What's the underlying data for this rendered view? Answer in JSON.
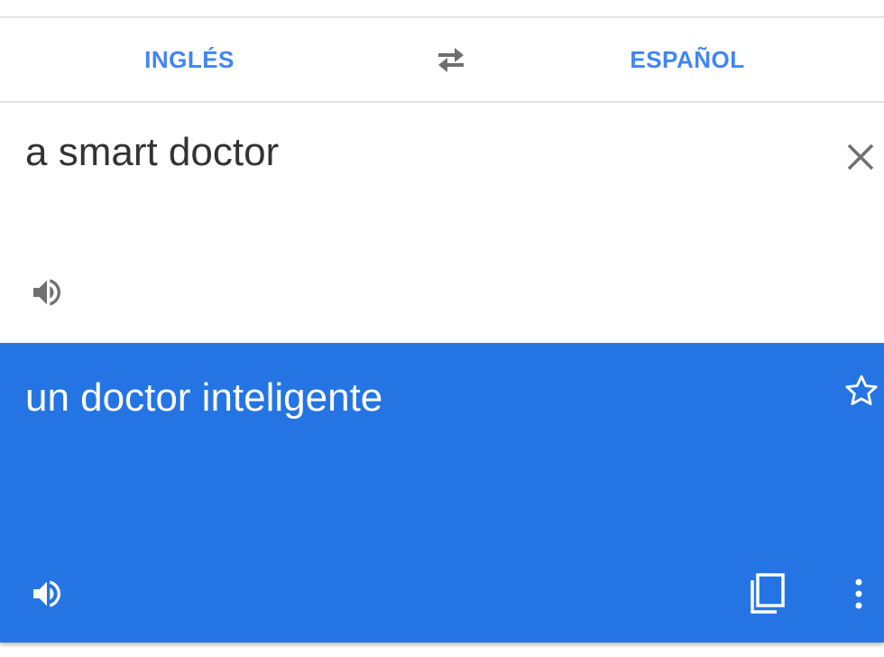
{
  "languages": {
    "source_label": "INGLÉS",
    "target_label": "ESPAÑOL",
    "swap_icon": "swap-arrows-icon"
  },
  "source": {
    "text": "a smart doctor",
    "clear_icon": "close-icon",
    "speaker_icon": "speaker-icon"
  },
  "result": {
    "text": "un doctor inteligente",
    "star_icon": "star-outline-icon",
    "speaker_icon": "speaker-icon",
    "copy_icon": "copy-icon",
    "more_icon": "more-vert-icon"
  },
  "colors": {
    "accent": "#4285f4",
    "result_background": "#2475e3",
    "text_primary": "#333333",
    "icon_gray": "#707070"
  }
}
